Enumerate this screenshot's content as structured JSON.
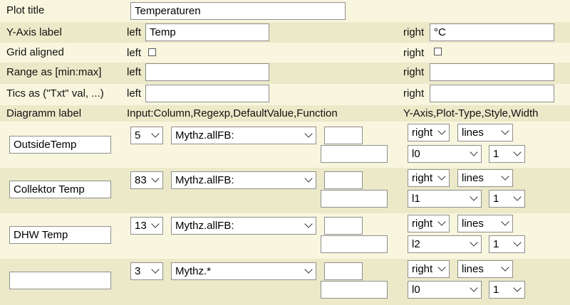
{
  "plot_title": {
    "label": "Plot title",
    "value": "Temperaturen"
  },
  "yaxis_label": {
    "label": "Y-Axis label",
    "left_label": "left",
    "left_value": "Temp",
    "right_label": "right",
    "right_value": "°C"
  },
  "grid_aligned": {
    "label": "Grid aligned",
    "left_label": "left",
    "left_checked": false,
    "right_label": "right",
    "right_checked": false
  },
  "range": {
    "label": "Range as [min:max]",
    "left_label": "left",
    "left_value": "",
    "right_label": "right",
    "right_value": ""
  },
  "tics": {
    "label": "Tics as (\"Txt\" val, ...)",
    "left_label": "left",
    "left_value": "",
    "right_label": "right",
    "right_value": ""
  },
  "header": {
    "diagram_label": "Diagramm label",
    "input": "Input:Column,Regexp,DefaultValue,Function",
    "yaxis": "Y-Axis,Plot-Type,Style,Width"
  },
  "series": [
    {
      "label": "OutsideTemp",
      "column": "5",
      "regexp": "Mythz.allFB:",
      "default": "",
      "function": "",
      "axis": "right",
      "plot_type": "lines",
      "style": "l0",
      "width": "1"
    },
    {
      "label": "Collektor Temp",
      "column": "83",
      "regexp": "Mythz.allFB:",
      "default": "",
      "function": "",
      "axis": "right",
      "plot_type": "lines",
      "style": "l1",
      "width": "1"
    },
    {
      "label": "DHW Temp",
      "column": "13",
      "regexp": "Mythz.allFB:",
      "default": "",
      "function": "",
      "axis": "right",
      "plot_type": "lines",
      "style": "l2",
      "width": "1"
    },
    {
      "label": "",
      "column": "3",
      "regexp": "Mythz.*",
      "default": "",
      "function": "",
      "axis": "right",
      "plot_type": "lines",
      "style": "l0",
      "width": "1"
    }
  ],
  "colors": {
    "row_light": "#f8f6de",
    "row_dark": "#ebe9c8",
    "background": "#fffff0"
  }
}
